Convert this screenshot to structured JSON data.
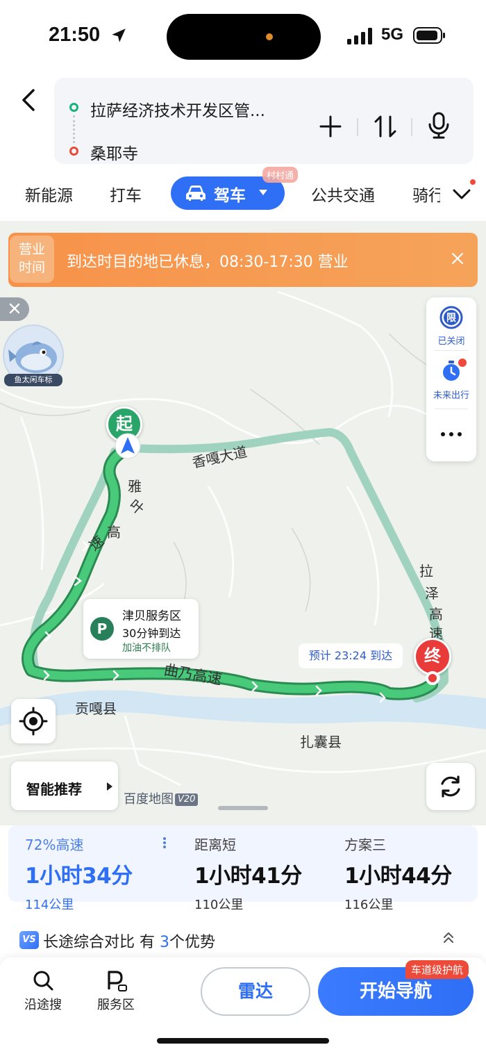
{
  "status_bar": {
    "time": "21:50",
    "network": "5G"
  },
  "search": {
    "start": "拉萨经济技术开发区管...",
    "end": "桑耶寺"
  },
  "tabs": {
    "items": [
      "新能源",
      "打车",
      "公共交通",
      "骑行"
    ],
    "active": "驾车",
    "active_badge": "村村通"
  },
  "banner": {
    "badge_line1": "营业",
    "badge_line2": "时间",
    "text": "到达时目的地已休息，08:30-17:30 营业"
  },
  "avatar": {
    "label": "鱼太闲车标"
  },
  "side_panel": {
    "restrict_icon": "限",
    "restrict_label": "已关闭",
    "future_label": "未来出行"
  },
  "map": {
    "start_marker": "起",
    "end_marker": "终",
    "road_labels": {
      "xianggu": "香嘎大道",
      "yagao": [
        "雅",
        "叶",
        "高",
        "速"
      ],
      "quna": "曲乃高速",
      "laze": [
        "拉",
        "泽",
        "高",
        "速"
      ]
    },
    "place_labels": {
      "gongga": "贡嘎县",
      "zhanang": "扎囊县"
    },
    "service_area": {
      "icon": "P",
      "name": "津贝服务区",
      "eta": "30分钟到达",
      "note": "加油不排队"
    },
    "eta_tag": "预计 23:24 到达",
    "brand": "百度地图",
    "brand_version": "V20",
    "smart_label": "智能推荐"
  },
  "routes": [
    {
      "tag": "72%高速",
      "time": "1小时34分",
      "distance": "114公里",
      "selected": true
    },
    {
      "tag": "距离短",
      "time": "1小时41分",
      "distance": "110公里",
      "selected": false
    },
    {
      "tag": "方案三",
      "time": "1小时44分",
      "distance": "116公里",
      "selected": false
    }
  ],
  "compare": {
    "icon": "VS",
    "prefix": "长途综合对比 有 ",
    "count": "3",
    "suffix": "个优势"
  },
  "bottom_bar": {
    "search_label": "沿途搜",
    "service_label": "服务区",
    "radar_label": "雷达",
    "start_label": "开始导航",
    "lane_badge": "车道级护航"
  },
  "colors": {
    "accent_blue": "#2f6ff5",
    "route_green": "#35b066",
    "alt_route": "#8fcab4",
    "banner_orange": "#f7924a",
    "end_red": "#ea3b3b"
  }
}
